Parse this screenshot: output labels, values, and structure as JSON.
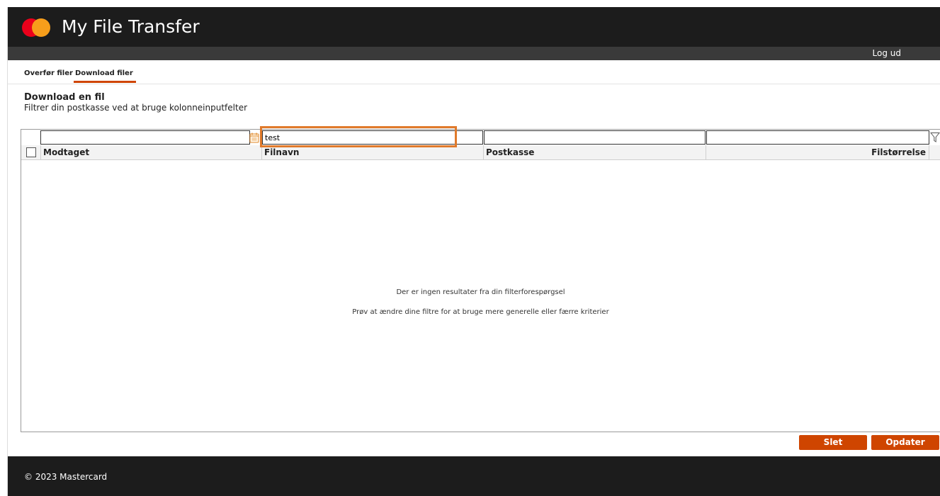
{
  "header": {
    "app_title": "My File Transfer",
    "logout_label": "Log ud",
    "brand_colors": {
      "red": "#eb001b",
      "orange": "#f79e1b",
      "overlap": "#ff5f00"
    }
  },
  "tabs": [
    {
      "label": "Overfør filer",
      "active": false
    },
    {
      "label": "Download filer",
      "active": true
    }
  ],
  "page": {
    "title": "Download en fil",
    "subtitle": "Filtrer din postkasse ved at bruge kolonneinputfelter"
  },
  "grid": {
    "filters": {
      "received": "",
      "filename": "test",
      "mailbox": "",
      "filesize": ""
    },
    "columns": [
      {
        "label": "Modtaget"
      },
      {
        "label": "Filnavn"
      },
      {
        "label": "Postkasse"
      },
      {
        "label": "Filstørrelse"
      }
    ],
    "empty_line1": "Der er ingen resultater fra din filterforespørgsel",
    "empty_line2": "Prøv at ændre dine filtre for at bruge mere generelle eller færre kriterier",
    "icons": {
      "date_filter": "calendar-icon",
      "filter": "funnel-icon"
    }
  },
  "actions": {
    "delete_label": "Slet",
    "refresh_label": "Opdater",
    "button_color": "#cf4500"
  },
  "highlight_color": "#e07a2b",
  "footer": {
    "text": "© 2023 Mastercard"
  }
}
